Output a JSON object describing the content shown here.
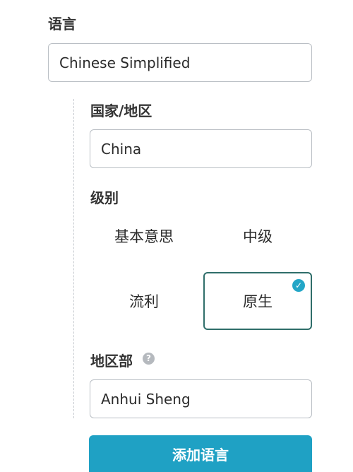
{
  "language": {
    "label": "语言",
    "value": "Chinese Simplified"
  },
  "country": {
    "label": "国家/地区",
    "value": "China"
  },
  "level": {
    "label": "级别",
    "options": [
      "基本意思",
      "中级",
      "流利",
      "原生"
    ],
    "selected": "原生"
  },
  "region": {
    "label": "地区部",
    "help": "?",
    "value": "Anhui Sheng"
  },
  "add_button": {
    "label": "添加语言"
  },
  "colors": {
    "accent": "#1fa1c4",
    "selected_border": "#2f6e6a",
    "check": "#23a6c7"
  },
  "icons": {
    "check": "checkmark-icon",
    "help": "question-mark-icon"
  }
}
